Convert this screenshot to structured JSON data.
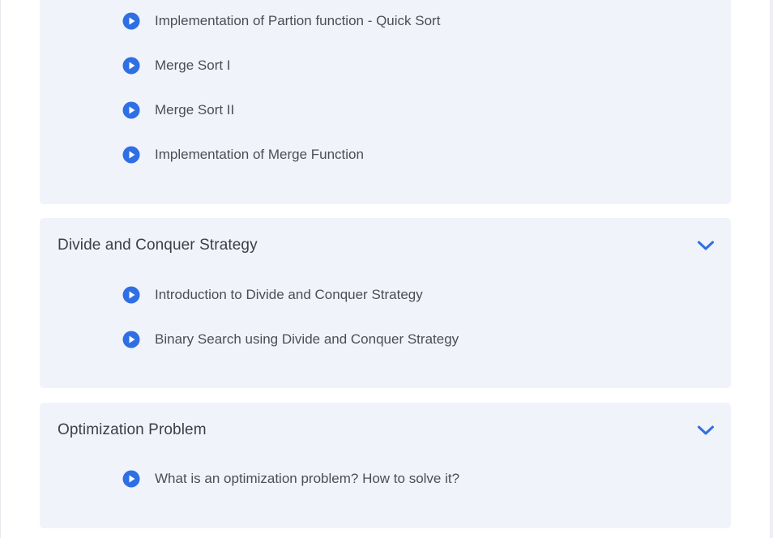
{
  "accent_color": "#2f6fe4",
  "sections": [
    {
      "title": "",
      "lessons": [
        {
          "label": "Implementation of Partion function - Quick Sort",
          "icon": "play-circle-icon"
        },
        {
          "label": "Merge Sort I",
          "icon": "play-circle-icon"
        },
        {
          "label": "Merge Sort II",
          "icon": "play-circle-icon"
        },
        {
          "label": "Implementation of Merge Function",
          "icon": "play-circle-icon"
        }
      ]
    },
    {
      "title": "Divide and Conquer Strategy",
      "expand_icon": "chevron-down-icon",
      "lessons": [
        {
          "label": "Introduction to Divide and Conquer Strategy",
          "icon": "play-circle-icon"
        },
        {
          "label": "Binary Search using Divide and Conquer Strategy",
          "icon": "play-circle-icon"
        }
      ]
    },
    {
      "title": "Optimization Problem",
      "expand_icon": "chevron-down-icon",
      "lessons": [
        {
          "label": "What is an optimization problem? How to solve it?",
          "icon": "play-circle-icon"
        }
      ]
    }
  ]
}
